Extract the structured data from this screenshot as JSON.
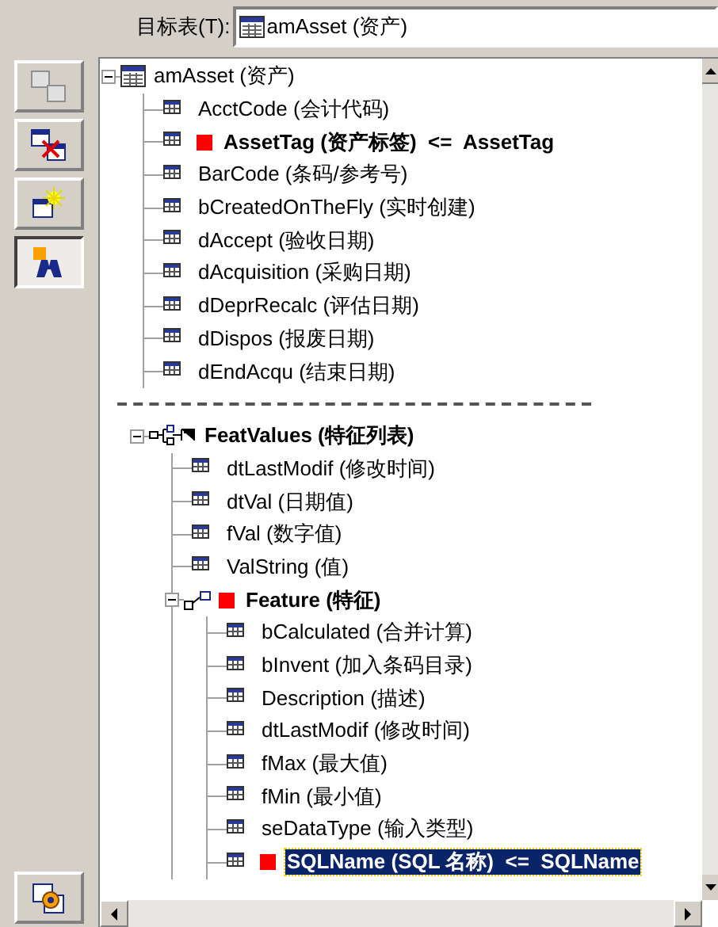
{
  "target": {
    "label": "目标表(T):",
    "value": "amAsset (资产)"
  },
  "toolbar": [
    {
      "kind": "link",
      "disabled": true,
      "pressed": false
    },
    {
      "kind": "unlink",
      "disabled": false,
      "pressed": false
    },
    {
      "kind": "new",
      "disabled": false,
      "pressed": false
    },
    {
      "kind": "find",
      "disabled": false,
      "pressed": true
    }
  ],
  "bottom_button": {
    "kind": "settings",
    "pressed": false
  },
  "tree": {
    "label": "amAsset (资产)",
    "kind": "table",
    "expanded": true,
    "children": [
      {
        "label": "AcctCode (会计代码)",
        "kind": "field",
        "mapped": false,
        "selected": false
      },
      {
        "label": "AssetTag (资产标签)",
        "kind": "field",
        "mapped": true,
        "arrow": "<=",
        "source": "AssetTag",
        "selected": false
      },
      {
        "label": "BarCode (条码/参考号)",
        "kind": "field",
        "mapped": false,
        "selected": false
      },
      {
        "label": "bCreatedOnTheFly (实时创建)",
        "kind": "field",
        "mapped": false,
        "selected": false
      },
      {
        "label": "dAccept (验收日期)",
        "kind": "field",
        "mapped": false,
        "selected": false
      },
      {
        "label": "dAcquisition (采购日期)",
        "kind": "field",
        "mapped": false,
        "selected": false
      },
      {
        "label": "dDeprRecalc (评估日期)",
        "kind": "field",
        "mapped": false,
        "selected": false
      },
      {
        "label": "dDispos (报废日期)",
        "kind": "field",
        "mapped": false,
        "selected": false
      },
      {
        "label": "dEndAcqu (结束日期)",
        "kind": "field",
        "mapped": false,
        "selected": false
      }
    ]
  },
  "tree_2": {
    "label": "FeatValues (特征列表)",
    "kind": "list",
    "expanded": true,
    "children": [
      {
        "label": "dtLastModif (修改时间)",
        "kind": "field",
        "mapped": false,
        "selected": false
      },
      {
        "label": "dtVal (日期值)",
        "kind": "field",
        "mapped": false,
        "selected": false
      },
      {
        "label": "fVal (数字值)",
        "kind": "field",
        "mapped": false,
        "selected": false
      },
      {
        "label": "ValString (值)",
        "kind": "field",
        "mapped": false,
        "selected": false
      },
      {
        "label": "Feature (特征)",
        "kind": "link",
        "expanded": true,
        "mapped": true,
        "children": [
          {
            "label": "bCalculated (合并计算)",
            "kind": "field",
            "mapped": false,
            "selected": false
          },
          {
            "label": "bInvent (加入条码目录)",
            "kind": "field",
            "mapped": false,
            "selected": false
          },
          {
            "label": "Description (描述)",
            "kind": "field",
            "mapped": false,
            "selected": false
          },
          {
            "label": "dtLastModif (修改时间)",
            "kind": "field",
            "mapped": false,
            "selected": false
          },
          {
            "label": "fMax (最大值)",
            "kind": "field",
            "mapped": false,
            "selected": false
          },
          {
            "label": "fMin (最小值)",
            "kind": "field",
            "mapped": false,
            "selected": false
          },
          {
            "label": "seDataType (输入类型)",
            "kind": "field",
            "mapped": false,
            "selected": false
          },
          {
            "label": "SQLName (SQL 名称)",
            "kind": "field",
            "mapped": true,
            "arrow": "<=",
            "source": "SQLName",
            "selected": true
          }
        ]
      }
    ]
  }
}
